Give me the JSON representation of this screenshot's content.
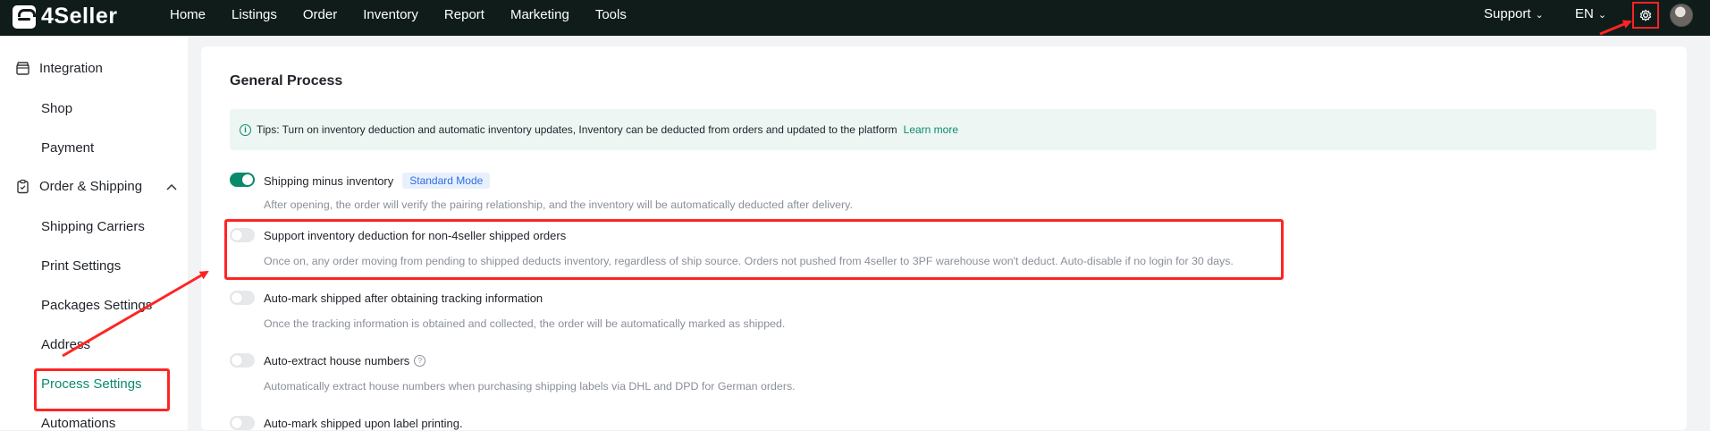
{
  "brand": {
    "name": "4Seller"
  },
  "nav": {
    "items": [
      "Home",
      "Listings",
      "Order",
      "Inventory",
      "Report",
      "Marketing",
      "Tools"
    ],
    "support": "Support",
    "language": "EN"
  },
  "sidebar": {
    "groups": [
      {
        "label": "Integration",
        "icon": "store-icon"
      },
      {
        "label": "Order & Shipping",
        "icon": "clipboard-icon"
      }
    ],
    "items": [
      "Shop",
      "Payment",
      "Shipping Carriers",
      "Print Settings",
      "Packages Settings",
      "Address",
      "Process Settings",
      "Automations"
    ],
    "active": "Process Settings"
  },
  "main": {
    "title": "General Process",
    "tips": {
      "text": "Tips: Turn on inventory deduction and automatic inventory updates, Inventory can be deducted from orders and updated to the platform",
      "link": "Learn more"
    },
    "settings": [
      {
        "title": "Shipping minus inventory",
        "badge": "Standard Mode",
        "enabled": true,
        "description": "After opening, the order will verify the pairing relationship, and the inventory will be automatically deducted after delivery."
      },
      {
        "title": "Support inventory deduction for non-4seller shipped orders",
        "enabled": false,
        "description": "Once on, any order moving from pending to shipped deducts inventory, regardless of ship source. Orders not pushed from 4seller to 3PF warehouse won't deduct. Auto-disable if no login for 30 days."
      },
      {
        "title": "Auto-mark shipped after obtaining tracking information",
        "enabled": false,
        "description": "Once the tracking information is obtained and collected, the order will be automatically marked as shipped."
      },
      {
        "title": "Auto-extract house numbers",
        "enabled": false,
        "help_icon": "question-circle-icon",
        "description": "Automatically extract house numbers when purchasing shipping labels via DHL and DPD for German orders."
      },
      {
        "title": "Auto-mark shipped upon label printing.",
        "enabled": false
      }
    ]
  },
  "colors": {
    "topbar": "#0f1c1a",
    "accent": "#0b8a6b",
    "annotation": "#ff2424"
  }
}
